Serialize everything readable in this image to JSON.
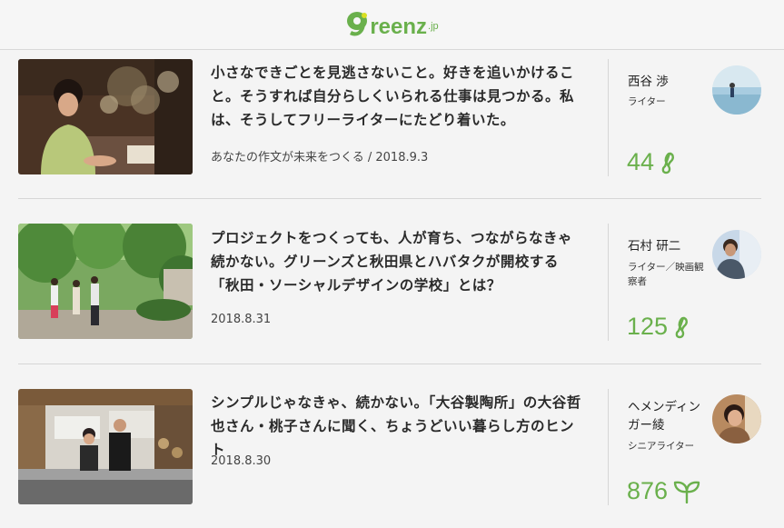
{
  "site": {
    "logo_text": "reenz",
    "logo_tld": ".jp",
    "brand_color": "#6ab04c"
  },
  "articles": [
    {
      "title": "小さなできごとを見逃さないこと。好きを追いかけること。そうすれば自分らしくいられる仕事は見つかる。私は、そうしてフリーライターにたどり着いた。",
      "meta": "あなたの作文が未来をつくる / 2018.9.3",
      "author_name": "西谷 渉",
      "author_role": "ライター",
      "count": "44",
      "count_icon": "greenz-seed-icon"
    },
    {
      "title": "プロジェクトをつくっても、人が育ち、つながらなきゃ続かない。グリーンズと秋田県とハバタクが開校する「秋田・ソーシャルデザインの学校」とは？",
      "meta": "2018.8.31",
      "author_name": "石村 研二",
      "author_role": "ライター／映画観察者",
      "count": "125",
      "count_icon": "greenz-seed-icon"
    },
    {
      "title": "シンプルじゃなきゃ、続かない。「大谷製陶所」の大谷哲也さん・桃子さんに聞く、ちょうどいい暮らし方のヒント",
      "meta": "2018.8.30",
      "author_name": "ヘメンディンガー綾",
      "author_role": "シニアライター",
      "count": "876",
      "count_icon": "greenz-sprout-icon"
    }
  ]
}
